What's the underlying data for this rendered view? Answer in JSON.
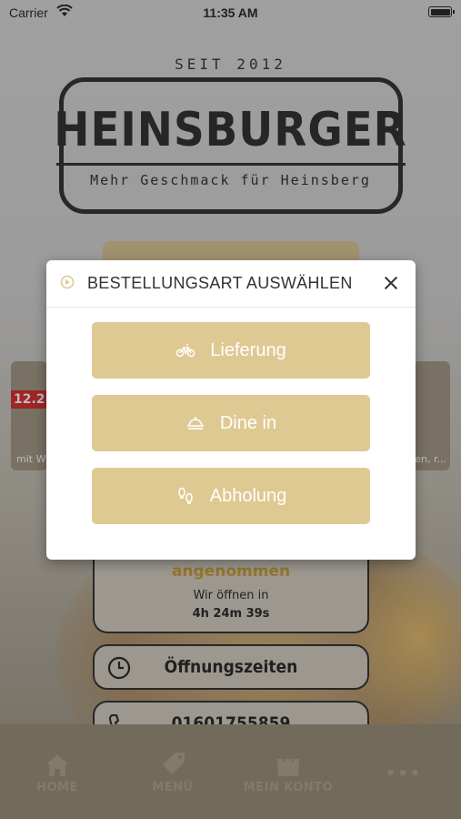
{
  "status_bar": {
    "carrier": "Carrier",
    "time": "11:35 AM"
  },
  "logo": {
    "since": "SEIT 2012",
    "name": "HEINSBURGER",
    "tagline": "Mehr Geschmack für Heinsberg"
  },
  "background": {
    "left_card": {
      "price": "12.2",
      "text": "mit W"
    },
    "right_card": {
      "text": "en, r..."
    },
    "status": {
      "accepted": "angenommen",
      "opens_label": "Wir öffnen in",
      "countdown": "4h  24m  39s"
    },
    "hours_label": "Öffnungszeiten",
    "phone": "01601755859"
  },
  "tabbar": {
    "items": [
      {
        "label": "HOME",
        "icon": "home-icon"
      },
      {
        "label": "MENÜ",
        "icon": "tag-icon"
      },
      {
        "label": "MEIN KONTO",
        "icon": "bag-icon"
      },
      {
        "label": "•••",
        "icon": "more-icon"
      }
    ]
  },
  "modal": {
    "title": "BESTELLUNGSART AUSWÄHLEN",
    "options": [
      {
        "label": "Lieferung",
        "icon": "bicycle-icon"
      },
      {
        "label": "Dine in",
        "icon": "dish-icon"
      },
      {
        "label": "Abholung",
        "icon": "footsteps-icon"
      }
    ]
  },
  "colors": {
    "accent": "#dfc993",
    "status_text": "#c79524",
    "tabbar": "#8f846c"
  }
}
